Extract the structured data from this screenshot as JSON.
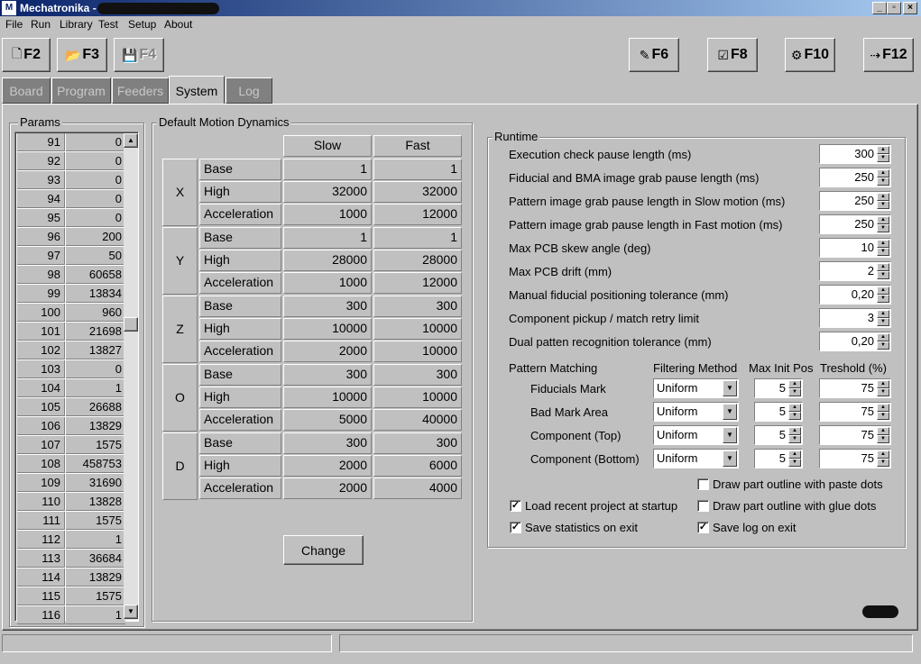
{
  "window": {
    "title": "Mechatronika - ",
    "app_icon": "M",
    "buttons": [
      "_",
      "▫",
      "×"
    ]
  },
  "menu": [
    "File",
    "Run",
    "Library",
    "Test",
    "Setup",
    "About"
  ],
  "toolbar": {
    "left": [
      {
        "label": "F2",
        "icon": "new-file-icon",
        "glyph": "🗋"
      },
      {
        "label": "F3",
        "icon": "open-folder-icon",
        "glyph": "📂"
      },
      {
        "label": "F4",
        "icon": "save-disk-icon",
        "glyph": "💾",
        "disabled": true
      }
    ],
    "right": [
      {
        "label": "F6",
        "icon": "nozzle-icon",
        "glyph": "✎"
      },
      {
        "label": "F8",
        "icon": "checklist-icon",
        "glyph": "☑"
      },
      {
        "label": "F10",
        "icon": "robot-icon",
        "glyph": "⚙"
      },
      {
        "label": "F12",
        "icon": "exit-icon",
        "glyph": "⇢"
      }
    ]
  },
  "tabs": [
    "Board",
    "Program",
    "Feeders",
    "System",
    "Log"
  ],
  "active_tab": "System",
  "params": {
    "title": "Params",
    "rows": [
      [
        "91",
        "0"
      ],
      [
        "92",
        "0"
      ],
      [
        "93",
        "0"
      ],
      [
        "94",
        "0"
      ],
      [
        "95",
        "0"
      ],
      [
        "96",
        "200"
      ],
      [
        "97",
        "50"
      ],
      [
        "98",
        "60658"
      ],
      [
        "99",
        "13834"
      ],
      [
        "100",
        "960"
      ],
      [
        "101",
        "21698"
      ],
      [
        "102",
        "13827"
      ],
      [
        "103",
        "0"
      ],
      [
        "104",
        "1"
      ],
      [
        "105",
        "26688"
      ],
      [
        "106",
        "13829"
      ],
      [
        "107",
        "1575"
      ],
      [
        "108",
        "458753"
      ],
      [
        "109",
        "31690"
      ],
      [
        "110",
        "13828"
      ],
      [
        "111",
        "1575"
      ],
      [
        "112",
        "1"
      ],
      [
        "113",
        "36684"
      ],
      [
        "114",
        "13829"
      ],
      [
        "115",
        "1575"
      ],
      [
        "116",
        "1"
      ]
    ]
  },
  "motion": {
    "title": "Default Motion Dynamics",
    "col_slow": "Slow",
    "col_fast": "Fast",
    "axes": [
      {
        "axis": "X",
        "rows": [
          [
            "Base",
            "1",
            "1"
          ],
          [
            "High",
            "32000",
            "32000"
          ],
          [
            "Acceleration",
            "1000",
            "12000"
          ]
        ]
      },
      {
        "axis": "Y",
        "rows": [
          [
            "Base",
            "1",
            "1"
          ],
          [
            "High",
            "28000",
            "28000"
          ],
          [
            "Acceleration",
            "1000",
            "12000"
          ]
        ]
      },
      {
        "axis": "Z",
        "rows": [
          [
            "Base",
            "300",
            "300"
          ],
          [
            "High",
            "10000",
            "10000"
          ],
          [
            "Acceleration",
            "2000",
            "10000"
          ]
        ]
      },
      {
        "axis": "O",
        "rows": [
          [
            "Base",
            "300",
            "300"
          ],
          [
            "High",
            "10000",
            "10000"
          ],
          [
            "Acceleration",
            "5000",
            "40000"
          ]
        ]
      },
      {
        "axis": "D",
        "rows": [
          [
            "Base",
            "300",
            "300"
          ],
          [
            "High",
            "2000",
            "6000"
          ],
          [
            "Acceleration",
            "2000",
            "4000"
          ]
        ]
      }
    ],
    "change_button": "Change"
  },
  "runtime": {
    "title": "Runtime",
    "fields": [
      {
        "label": "Execution check pause length (ms)",
        "value": "300"
      },
      {
        "label": "Fiducial and BMA image grab pause length (ms)",
        "value": "250"
      },
      {
        "label": "Pattern image grab pause length in Slow motion (ms)",
        "value": "250"
      },
      {
        "label": "Pattern image grab pause length in Fast motion (ms)",
        "value": "250"
      },
      {
        "label": "Max PCB skew angle (deg)",
        "value": "10"
      },
      {
        "label": "Max PCB drift (mm)",
        "value": "2"
      },
      {
        "label": "Manual fiducial positioning tolerance (mm)",
        "value": "0,20"
      },
      {
        "label": "Component pickup / match retry limit",
        "value": "3"
      },
      {
        "label": "Dual patten recognition tolerance (mm)",
        "value": "0,20"
      }
    ],
    "pattern": {
      "label": "Pattern Matching",
      "col_filter": "Filtering Method",
      "col_init": "Max Init Pos",
      "col_threshold": "Treshold (%)",
      "rows": [
        {
          "name": "Fiducials Mark",
          "filter": "Uniform",
          "init": "5",
          "threshold": "75"
        },
        {
          "name": "Bad Mark Area",
          "filter": "Uniform",
          "init": "5",
          "threshold": "75"
        },
        {
          "name": "Component (Top)",
          "filter": "Uniform",
          "init": "5",
          "threshold": "75"
        },
        {
          "name": "Component (Bottom)",
          "filter": "Uniform",
          "init": "5",
          "threshold": "75"
        }
      ]
    },
    "checks": [
      {
        "label": "Draw part outline with paste dots",
        "checked": false
      },
      {
        "label": "Load recent project at startup",
        "checked": true
      },
      {
        "label": "Draw part outline with glue dots",
        "checked": false
      },
      {
        "label": "Save statistics on exit",
        "checked": true
      },
      {
        "label": "Save log on exit",
        "checked": true
      }
    ]
  },
  "scroll_arrows": {
    "up": "▲",
    "down": "▼"
  }
}
